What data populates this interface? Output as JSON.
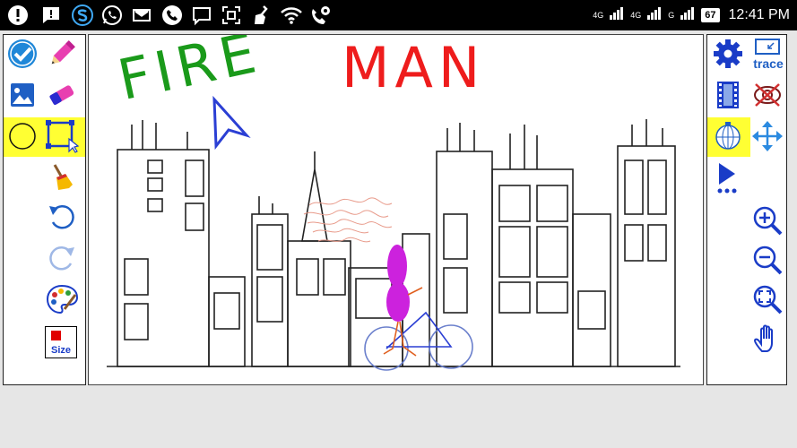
{
  "status_bar": {
    "network_4g_top": "4G",
    "network_4g": "4G",
    "network_g": "G",
    "battery_level": "67",
    "time": "12:41 PM",
    "notification_icons": [
      "alert-icon",
      "message-alert-icon",
      "s-app-icon",
      "whatsapp-icon",
      "gmail-icon",
      "phone-icon",
      "chat-icon",
      "screenshot-icon",
      "cleaner-icon",
      "wifi-icon",
      "call-settings-icon"
    ]
  },
  "left_toolbar": {
    "items": [
      "check-icon",
      "pencil-icon",
      "image-icon",
      "eraser-icon",
      "circle-tool-icon",
      "rectangle-select-icon",
      "broom-icon",
      "undo-icon",
      "redo-icon",
      "palette-icon",
      "size-button"
    ],
    "size_label": "Size",
    "highlight_color": "#ffff33"
  },
  "right_toolbar": {
    "items": [
      "settings-gear-icon",
      "trace-icon",
      "film-icon",
      "hide-eye-icon",
      "globe-icon",
      "move-arrows-icon",
      "play-more-icon",
      "zoom-in-icon",
      "zoom-out-icon",
      "zoom-fit-icon",
      "hand-pan-icon"
    ],
    "trace_label": "trace",
    "accent_color": "#1a3cc7"
  },
  "canvas": {
    "title_word1": "FIRE",
    "title_word2": "MAN",
    "title_word1_color": "#1a9a1a",
    "title_word2_color": "#ee1c1c",
    "figure_color": "#cc22dd"
  }
}
